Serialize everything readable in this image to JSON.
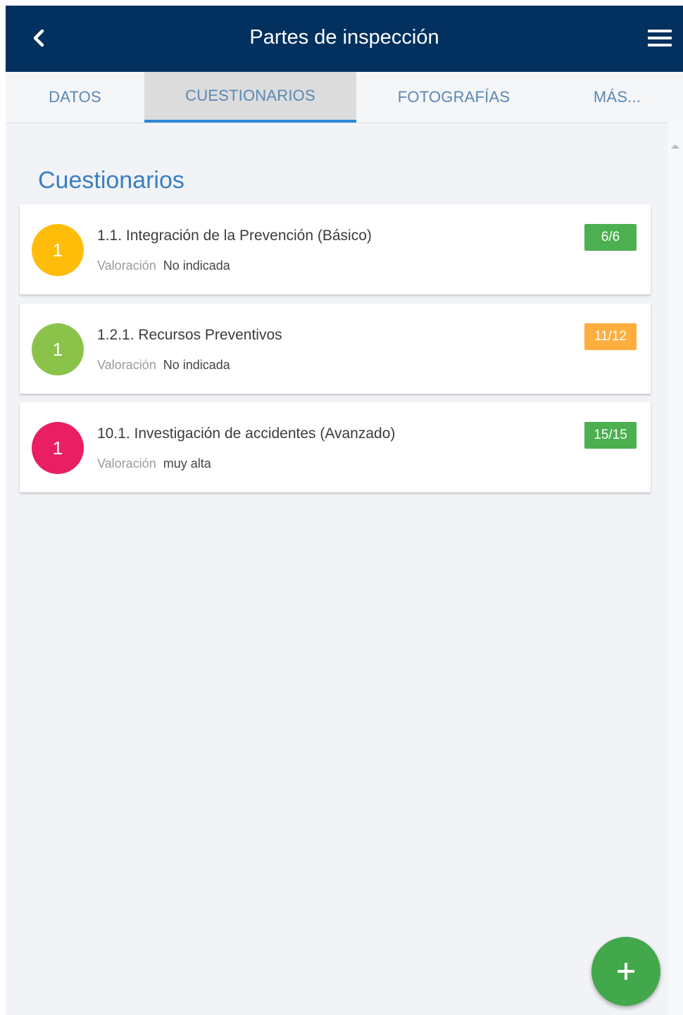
{
  "header": {
    "title": "Partes de inspección",
    "back_icon": "chevron-left-icon",
    "menu_icon": "hamburger-menu-icon"
  },
  "tabs": [
    {
      "label": "DATOS",
      "active": false
    },
    {
      "label": "CUESTIONARIOS",
      "active": true
    },
    {
      "label": "FOTOGRAFÍAS",
      "active": false
    },
    {
      "label": "MÁS...",
      "active": false
    }
  ],
  "section": {
    "title": "Cuestionarios"
  },
  "questionnaires": [
    {
      "count": "1",
      "title": "1.1. Integración de la Prevención (Básico)",
      "valoracion_label": "Valoración",
      "valoracion_value": "No indicada",
      "progress": "6/6",
      "avatar_color": "#ffbd0a",
      "badge_color": "#4caf50"
    },
    {
      "count": "1",
      "title": "1.2.1. Recursos Preventivos",
      "valoracion_label": "Valoración",
      "valoracion_value": "No indicada",
      "progress": "11/12",
      "avatar_color": "#8bc34a",
      "badge_color": "#ffad3c"
    },
    {
      "count": "1",
      "title": "10.1. Investigación de accidentes (Avanzado)",
      "valoracion_label": "Valoración",
      "valoracion_value": "muy alta",
      "progress": "15/15",
      "avatar_color": "#e91e63",
      "badge_color": "#4caf50"
    }
  ],
  "fab": {
    "icon": "plus-icon"
  },
  "colors": {
    "header_bg": "#02305f",
    "tab_text": "#5b87b5",
    "tab_active_indicator": "#2f86d8",
    "section_title": "#3a7ec0",
    "fab_bg": "#43a84b"
  }
}
